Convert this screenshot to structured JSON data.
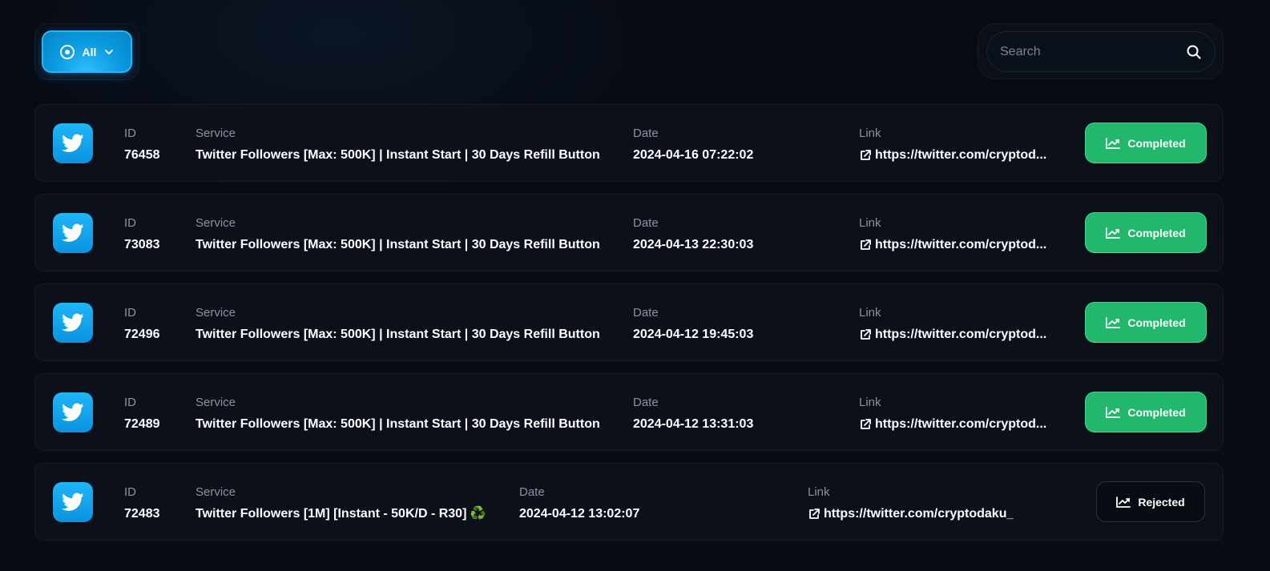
{
  "filter": {
    "label": "All"
  },
  "search": {
    "placeholder": "Search"
  },
  "columns": {
    "id": "ID",
    "service": "Service",
    "date": "Date",
    "link": "Link"
  },
  "colors": {
    "accent": "#0a9ae0",
    "completed": "#22b86b",
    "rejected_bg": "#080c13"
  },
  "orders": [
    {
      "id": "76458",
      "service": "Twitter Followers [Max: 500K] | Instant Start | 30 Days Refill Button",
      "date": "2024-04-16 07:22:02",
      "link": "https://twitter.com/cryptod...",
      "status": "Completed",
      "icon": "twitter-icon"
    },
    {
      "id": "73083",
      "service": "Twitter Followers [Max: 500K] | Instant Start | 30 Days Refill Button",
      "date": "2024-04-13 22:30:03",
      "link": "https://twitter.com/cryptod...",
      "status": "Completed",
      "icon": "twitter-icon"
    },
    {
      "id": "72496",
      "service": "Twitter Followers [Max: 500K] | Instant Start | 30 Days Refill Button",
      "date": "2024-04-12 19:45:03",
      "link": "https://twitter.com/cryptod...",
      "status": "Completed",
      "icon": "twitter-icon"
    },
    {
      "id": "72489",
      "service": "Twitter Followers [Max: 500K] | Instant Start | 30 Days Refill Button",
      "date": "2024-04-12 13:31:03",
      "link": "https://twitter.com/cryptod...",
      "status": "Completed",
      "icon": "twitter-icon"
    },
    {
      "id": "72483",
      "service": "Twitter Followers [1M] [Instant - 50K/D - R30] ♻️",
      "date": "2024-04-12 13:02:07",
      "link": "https://twitter.com/cryptodaku_",
      "status": "Rejected",
      "icon": "twitter-icon"
    }
  ]
}
